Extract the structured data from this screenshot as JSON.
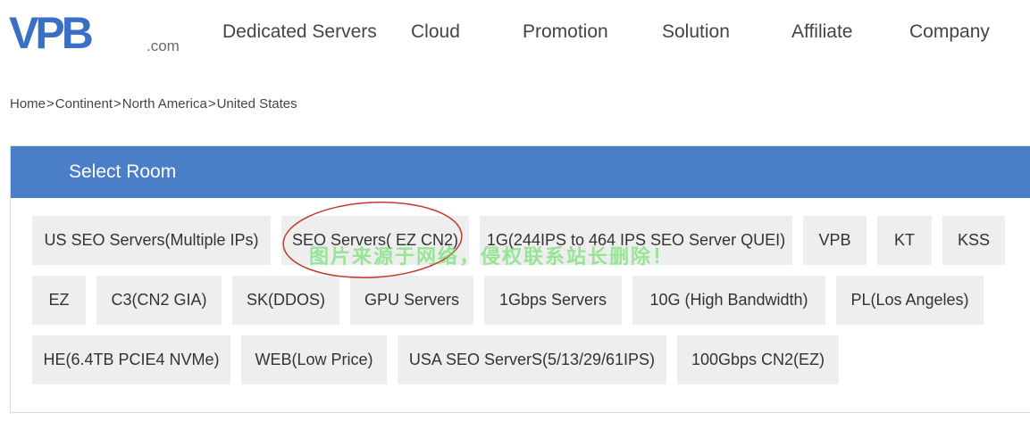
{
  "logo": {
    "mark": "VPB",
    "suffix": ".com",
    "color": "#3a6fc6"
  },
  "nav": {
    "items": [
      {
        "label": "Dedicated Servers"
      },
      {
        "label": "Cloud"
      },
      {
        "label": "Promotion"
      },
      {
        "label": "Solution"
      },
      {
        "label": "Affiliate"
      },
      {
        "label": "Company"
      }
    ]
  },
  "breadcrumb": {
    "items": [
      "Home",
      "Continent",
      "North America",
      "United States"
    ],
    "separator": ">"
  },
  "panel": {
    "title": "Select Room",
    "header_color": "#4a7fc8",
    "rooms": [
      {
        "label": "US SEO Servers(Multiple IPs)"
      },
      {
        "label": "SEO Servers( EZ CN2)"
      },
      {
        "label": "1G(244IPS to 464 IPS SEO Server QUEI)"
      },
      {
        "label": "VPB"
      },
      {
        "label": "KT"
      },
      {
        "label": "KSS"
      },
      {
        "label": "EZ"
      },
      {
        "label": "C3(CN2 GIA)"
      },
      {
        "label": "SK(DDOS)"
      },
      {
        "label": "GPU Servers"
      },
      {
        "label": "1Gbps Servers"
      },
      {
        "label": "10G (High Bandwidth)"
      },
      {
        "label": "PL(Los Angeles)"
      },
      {
        "label": "HE(6.4TB PCIE4 NVMe)"
      },
      {
        "label": "WEB(Low Price)"
      },
      {
        "label": "USA SEO ServerS(5/13/29/61IPS)"
      },
      {
        "label": "100Gbps CN2(EZ)"
      }
    ]
  },
  "watermark": {
    "text": "图片来源于网络，侵权联系站长删除！",
    "color": "#50dc50"
  },
  "annotation": {
    "shape": "ellipse",
    "color": "#c0392b"
  }
}
